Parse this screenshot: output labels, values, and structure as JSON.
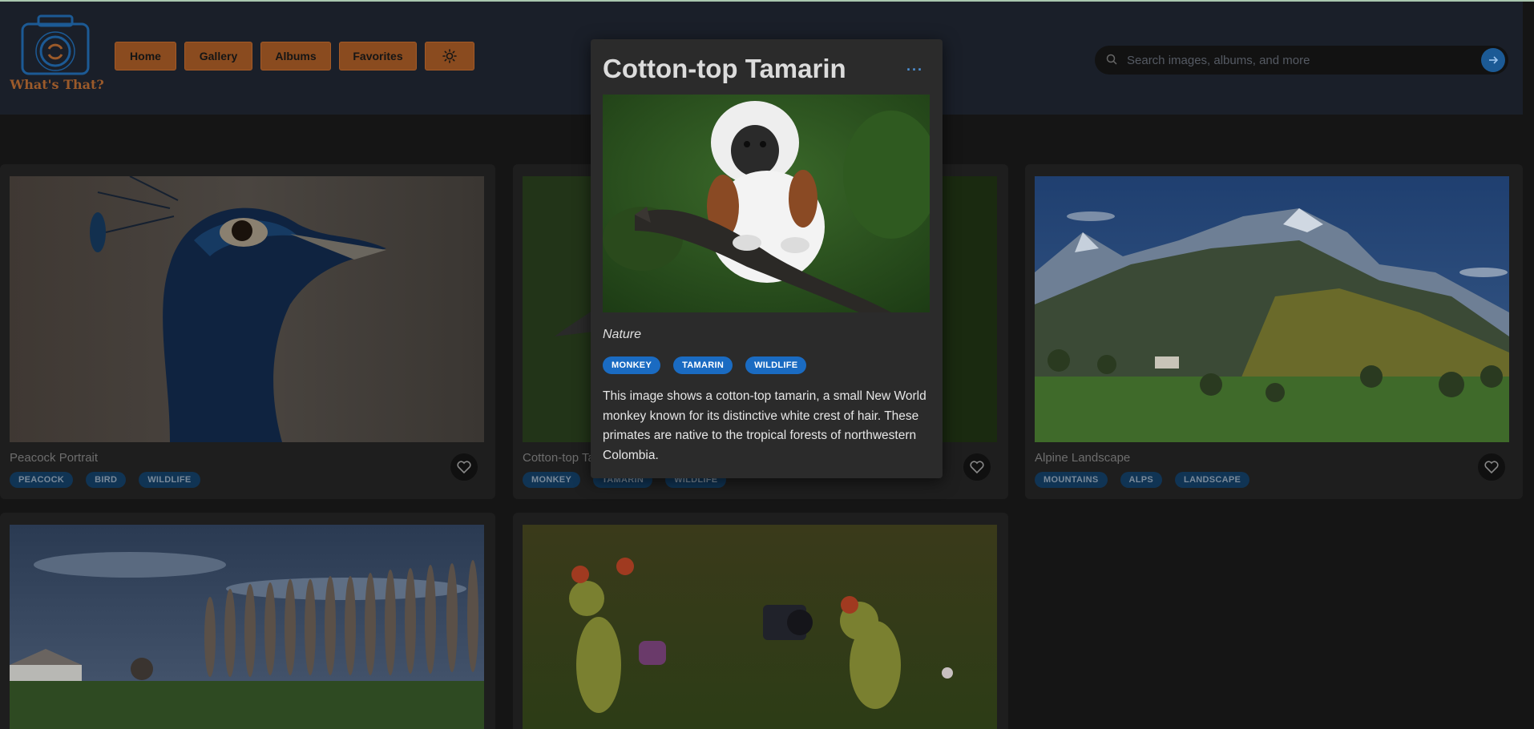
{
  "app": {
    "logo_text": "What's That?"
  },
  "nav": {
    "items": [
      {
        "label": "Home"
      },
      {
        "label": "Gallery"
      },
      {
        "label": "Albums"
      },
      {
        "label": "Favorites"
      }
    ],
    "theme_toggle_icon": "sun-icon"
  },
  "search": {
    "placeholder": "Search images, albums, and more",
    "value": ""
  },
  "cards": [
    {
      "title": "Peacock Portrait",
      "tags": [
        "PEACOCK",
        "BIRD",
        "WILDLIFE"
      ]
    },
    {
      "title": "Cotton-top Tamarin",
      "tags": [
        "MONKEY",
        "TAMARIN",
        "WILDLIFE"
      ]
    },
    {
      "title": "Alpine Landscape",
      "tags": [
        "MOUNTAINS",
        "ALPS",
        "LANDSCAPE"
      ]
    },
    {
      "title": "",
      "tags": []
    },
    {
      "title": "",
      "tags": []
    }
  ],
  "popup": {
    "title": "Cotton-top Tamarin",
    "menu": "···",
    "category": "Nature",
    "tags": [
      "MONKEY",
      "TAMARIN",
      "WILDLIFE"
    ],
    "description": "This image shows a cotton-top tamarin, a small New World monkey known for its distinctive white crest of hair. These primates are native to the tropical forests of northwestern Colombia."
  },
  "colors": {
    "accent": "#8a4b1f",
    "tag_blue": "#1a6bc2",
    "background": "#151515"
  }
}
